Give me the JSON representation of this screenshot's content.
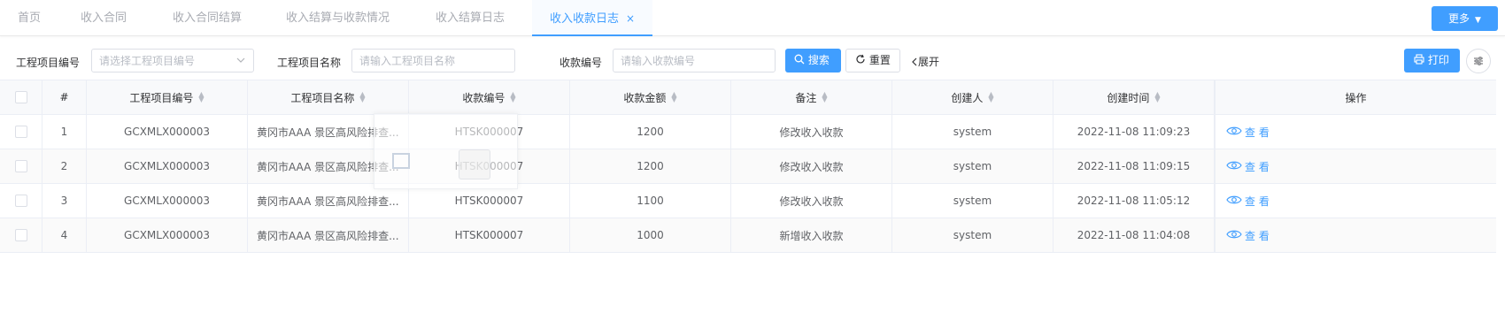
{
  "tabs": [
    {
      "label": "首页",
      "active": false
    },
    {
      "label": "收入合同",
      "active": false
    },
    {
      "label": "收入合同结算",
      "active": false
    },
    {
      "label": "收入结算与收款情况",
      "active": false
    },
    {
      "label": "收入结算日志",
      "active": false
    },
    {
      "label": "收入收款日志",
      "active": true,
      "closable": true
    }
  ],
  "tab_close_glyph": "×",
  "more_button": {
    "label": "更多",
    "icon": "caret-down-icon"
  },
  "filters": {
    "project_code_label": "工程项目编号",
    "project_code_placeholder": "请选择工程项目编号",
    "project_name_label": "工程项目名称",
    "project_name_placeholder": "请输入工程项目名称",
    "receipt_no_label": "收款编号",
    "receipt_no_placeholder": "请输入收款编号"
  },
  "actions": {
    "search_label": "搜索",
    "reset_label": "重置",
    "expand_label": "展开",
    "print_label": "打印"
  },
  "table": {
    "headers": {
      "index": "#",
      "project_code": "工程项目编号",
      "project_name": "工程项目名称",
      "receipt_no": "收款编号",
      "amount": "收款金额",
      "remark": "备注",
      "creator": "创建人",
      "created_at": "创建时间",
      "operation": "操作"
    },
    "rows": [
      {
        "index": "1",
        "project_code": "GCXMLX000003",
        "project_name": "黄冈市AAA 景区高风险排查...",
        "receipt_no": "HTSK000007",
        "amount": "1200",
        "remark": "修改收入收款",
        "creator": "system",
        "created_at": "2022-11-08 11:09:23",
        "action": "查 看"
      },
      {
        "index": "2",
        "project_code": "GCXMLX000003",
        "project_name": "黄冈市AAA 景区高风险排查...",
        "receipt_no": "HTSK000007",
        "amount": "1200",
        "remark": "修改收入收款",
        "creator": "system",
        "created_at": "2022-11-08 11:09:15",
        "action": "查 看"
      },
      {
        "index": "3",
        "project_code": "GCXMLX000003",
        "project_name": "黄冈市AAA 景区高风险排查...",
        "receipt_no": "HTSK000007",
        "amount": "1100",
        "remark": "修改收入收款",
        "creator": "system",
        "created_at": "2022-11-08 11:05:12",
        "action": "查 看"
      },
      {
        "index": "4",
        "project_code": "GCXMLX000003",
        "project_name": "黄冈市AAA 景区高风险排查...",
        "receipt_no": "HTSK000007",
        "amount": "1000",
        "remark": "新增收入收款",
        "creator": "system",
        "created_at": "2022-11-08 11:04:08",
        "action": "查 看"
      }
    ]
  },
  "colors": {
    "primary": "#409eff",
    "border": "#ebeef5",
    "header_bg": "#f8f9fb",
    "muted_tab": "#a8abb2"
  }
}
